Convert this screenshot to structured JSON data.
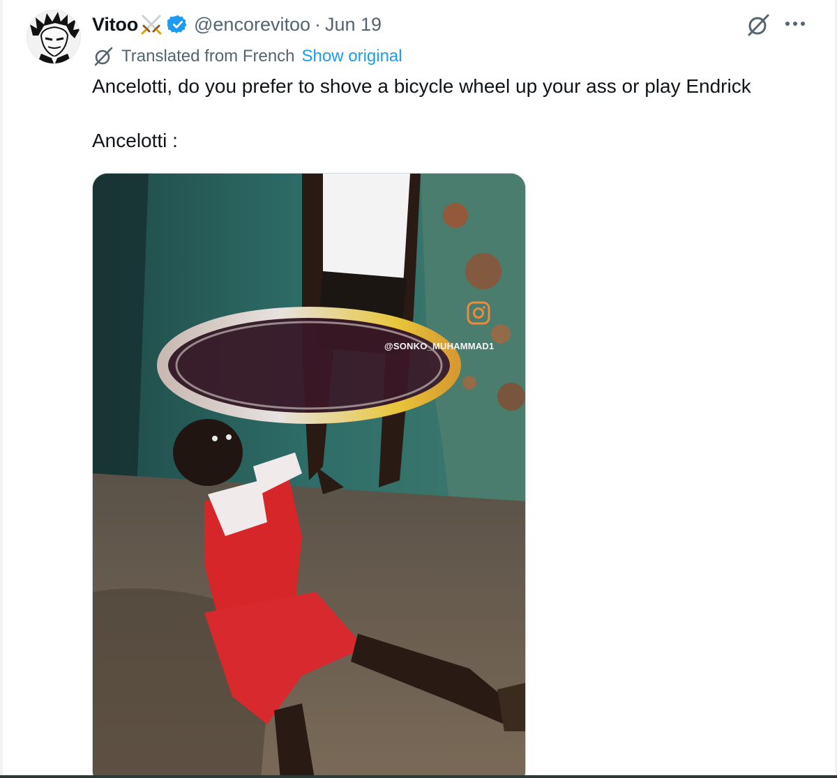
{
  "tweet": {
    "author_name": "Vitoo",
    "author_handle": "@encorevitoo",
    "separator": "·",
    "date": "Jun 19",
    "translation_notice": "Translated from French",
    "show_original_label": "Show original",
    "text_lines": [
      "Ancelotti, do you prefer to shove a bicycle wheel up your ass or play Endrick",
      "Ancelotti :"
    ],
    "media": {
      "type": "video-still",
      "watermark": "@SONKO_MUHAMMAD1"
    }
  },
  "icons": {
    "name_emoji": "crossed-swords-icon",
    "verified": "verified-badge-icon",
    "translate": "grok-slash-icon",
    "more": "more-options-icon"
  },
  "colors": {
    "text": "#0f1419",
    "muted": "#536471",
    "link": "#1d9bf0",
    "verified": "#1d9bf0"
  }
}
